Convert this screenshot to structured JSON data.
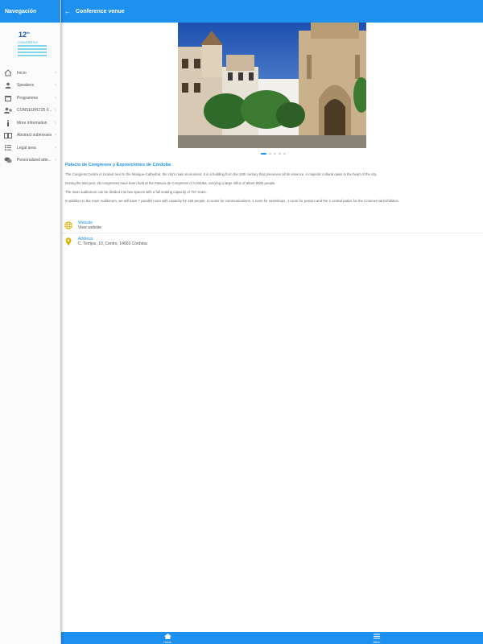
{
  "sidebar": {
    "title": "Navegación",
    "logo": {
      "number": "12",
      "sup": "th",
      "line1": "CONGRESO"
    },
    "items": [
      {
        "label": "Inicio",
        "icon": "home-icon"
      },
      {
        "label": "Speakers",
        "icon": "person-icon"
      },
      {
        "label": "Programme",
        "icon": "calendar-icon"
      },
      {
        "label": "CONSEURO'25 F...",
        "icon": "group-add-icon"
      },
      {
        "label": "More information",
        "icon": "info-icon"
      },
      {
        "label": "Abstract submission",
        "icon": "book-icon"
      },
      {
        "label": "Legal area",
        "icon": "list-icon"
      },
      {
        "label": "Personalized atte...",
        "icon": "chat-icon"
      }
    ]
  },
  "header": {
    "title": "Conference venue"
  },
  "carousel": {
    "slides": 5,
    "active": 0
  },
  "venue": {
    "title": "Palacio de Congresos y Exposiciones de Córdoba",
    "paragraphs": [
      "The Congress Centre is located next to the Mosque-Cathedral, the city's main monument. It is a building from the 16th century that preserves all its essence. A majestic cultural oasis in the heart of the city.",
      "During the last year, 25 congresses have been held at the Palacio de Congresos of Córdoba, carrying a large influx of about 9000 people.",
      "The main auditorium can be divided into two spaces with a full seating capacity of 757 seats.",
      "In addition to the main Auditorium, we will have 7 parallel room with capacity for 150 people, 3 rooms for communications, 1 room for workshops, 1 room for posters and the 2 central patios for the Commercial Exhibition."
    ]
  },
  "info": {
    "website_label": "Website",
    "website_value": "View website",
    "address_label": "Address",
    "address_value": "C. Torrijos, 10, Centro, 14003 Córdoba"
  },
  "tabs": {
    "home": "Home",
    "menu": "Menu"
  },
  "colors": {
    "primary": "#1e90f0",
    "accent": "#f0b400"
  }
}
